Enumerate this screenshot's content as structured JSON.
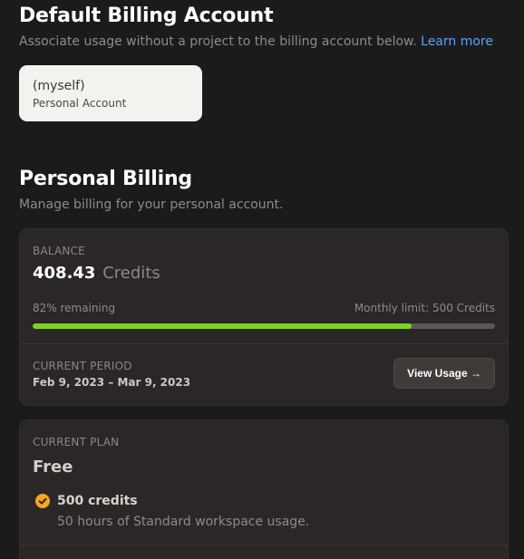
{
  "default_billing": {
    "title": "Default Billing Account",
    "description": "Associate usage without a project to the billing account below.",
    "learn_more": "Learn more",
    "account": {
      "name": "(myself)",
      "type": "Personal Account"
    }
  },
  "personal_billing": {
    "title": "Personal Billing",
    "description": "Manage billing for your personal account.",
    "balance": {
      "label": "BALANCE",
      "amount": "408.43",
      "unit": "Credits",
      "remaining_text": "82% remaining",
      "remaining_fraction": 0.82,
      "monthly_limit_text": "Monthly limit: 500 Credits",
      "current_period_label": "CURRENT PERIOD",
      "current_period_value": "Feb 9, 2023 – Mar 9, 2023",
      "view_usage_label": "View Usage →"
    },
    "plan": {
      "label": "CURRENT PLAN",
      "name": "Free",
      "feature_title": "500 credits",
      "feature_desc": "50 hours of Standard workspace usage."
    }
  },
  "colors": {
    "accent_green": "#7ed321",
    "link_blue": "#5aa3f7",
    "check_orange": "#f5a623"
  },
  "icons": {
    "feature_check": "check-circle-icon"
  }
}
